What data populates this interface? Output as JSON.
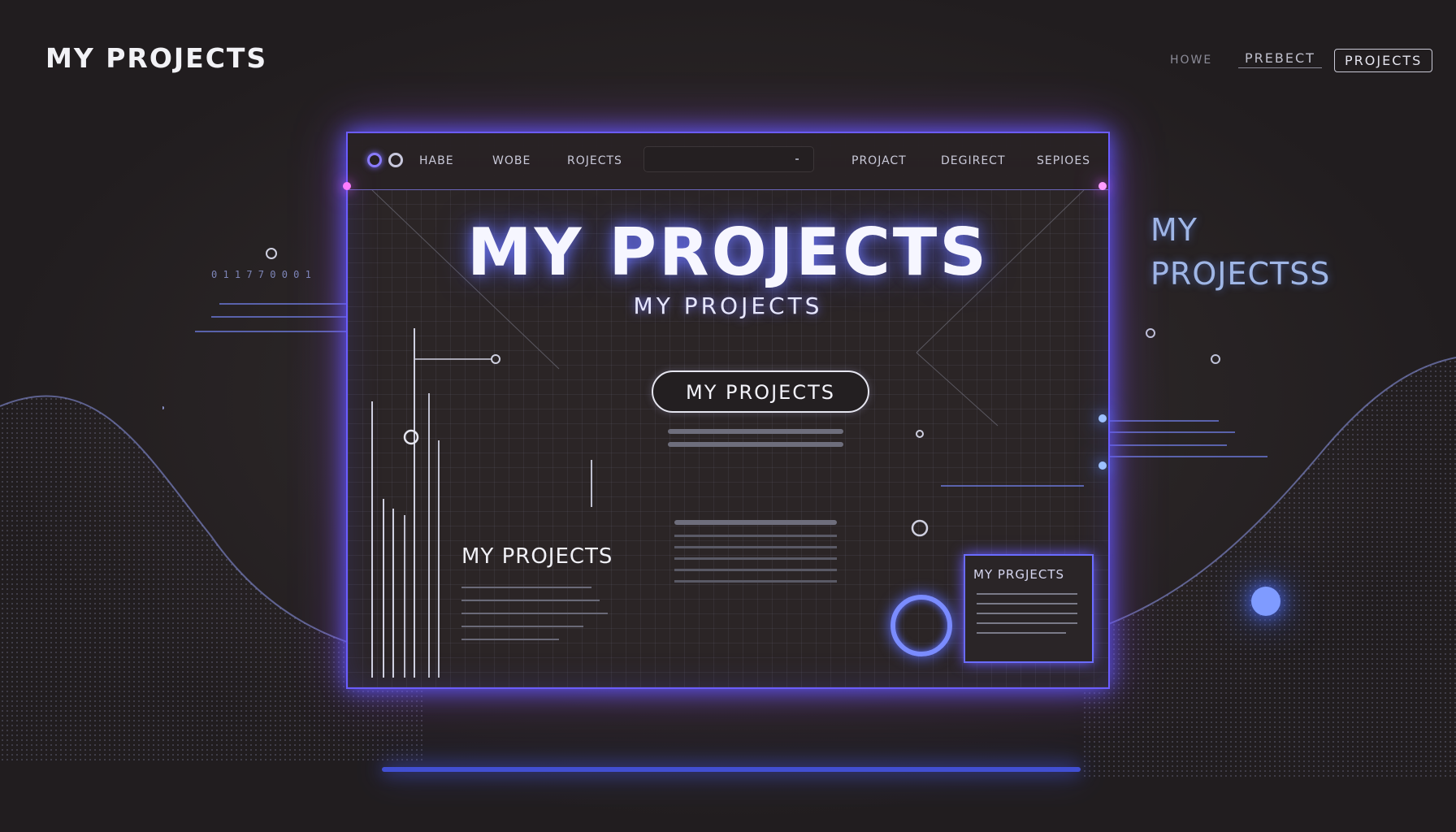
{
  "header": {
    "title": "MY PROJECTS",
    "nav": [
      "HOWE",
      "PREBECT",
      "PROJECTS"
    ]
  },
  "window": {
    "tabs_left": [
      "HABE",
      "WOBE",
      "ROJECTS"
    ],
    "tabs_right": [
      "PROJACT",
      "DEGIRECT",
      "SEPIOES"
    ],
    "hero_title": "MY PROJECTS",
    "hero_subtitle": "MY PROJECTS",
    "cta_label": "MY PROJECTS",
    "left_label": "MY PROJECTS",
    "mini_card_title": "MY PRGJECTS"
  },
  "side": {
    "line1": "MY",
    "line2": "PROJECTSS"
  },
  "colors": {
    "accent_blue": "#5b6cff",
    "accent_purple": "#b04cff",
    "background": "#2a2526"
  }
}
